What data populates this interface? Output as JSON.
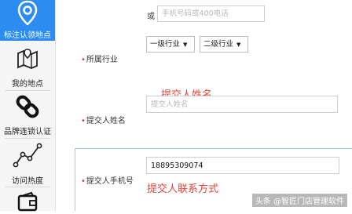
{
  "sidebar": {
    "items": [
      {
        "label": "标注认领地点",
        "icon": "map-pin-icon",
        "active": true
      },
      {
        "label": "我的地点",
        "icon": "folded-map-icon",
        "active": false
      },
      {
        "label": "品牌连锁认证",
        "icon": "chain-link-icon",
        "active": false
      },
      {
        "label": "访问热度",
        "icon": "trend-line-icon",
        "active": false
      },
      {
        "label": "",
        "icon": "wallet-icon",
        "active": false
      }
    ],
    "accent": "#2d8cf0"
  },
  "form": {
    "or_label": "或",
    "phone_alt_placeholder": "手机号码或400电话",
    "industry": {
      "label": "所属行业",
      "level1": "一级行业",
      "level2": "二级行业"
    },
    "submitter_name": {
      "label": "提交人姓名",
      "placeholder": "提交人姓名",
      "annotation": "提交人姓名"
    },
    "submitter_phone": {
      "label": "提交人手机号",
      "value": "18895309074",
      "annotation": "提交人联系方式"
    }
  },
  "watermark": "头条 @智匠门店管理软件",
  "colors": {
    "required": "#e23a3a",
    "annotation": "#e0463a",
    "border_focus": "#9ec9ea"
  }
}
